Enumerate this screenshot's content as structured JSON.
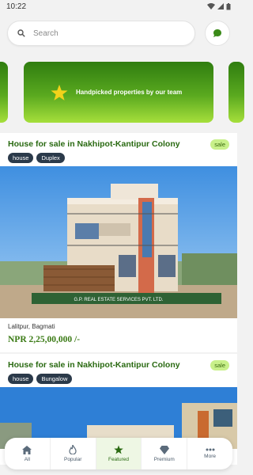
{
  "status_bar": {
    "time": "10:22"
  },
  "search": {
    "placeholder": "Search"
  },
  "banner": {
    "text": "Handpicked properties by our team"
  },
  "listings": [
    {
      "title": "House for sale in Nakhipot-Kantipur Colony",
      "badge": "sale",
      "tags": [
        "house",
        "Duplex"
      ],
      "watermark": "G.P. REAL ESTATE SERVICES PVT. LTD.",
      "location": "Lalitpur, Bagmati",
      "price": "NPR 2,25,00,000 /-"
    },
    {
      "title": "House for sale in Nakhipot-Kantipur Colony",
      "badge": "sale",
      "tags": [
        "house",
        "Bungalow"
      ]
    }
  ],
  "nav": {
    "items": [
      {
        "label": "All",
        "icon": "home-icon"
      },
      {
        "label": "Popular",
        "icon": "fire-icon"
      },
      {
        "label": "Featured",
        "icon": "star-icon"
      },
      {
        "label": "Premium",
        "icon": "diamond-icon"
      },
      {
        "label": "More",
        "icon": "more-dots-icon"
      }
    ],
    "active": "Featured"
  },
  "colors": {
    "accent": "#2a6a12",
    "banner_top": "#2f7d10",
    "banner_bottom": "#a6df3b",
    "tag_bg": "#2b3a4a",
    "badge_bg": "#c8f08a"
  }
}
